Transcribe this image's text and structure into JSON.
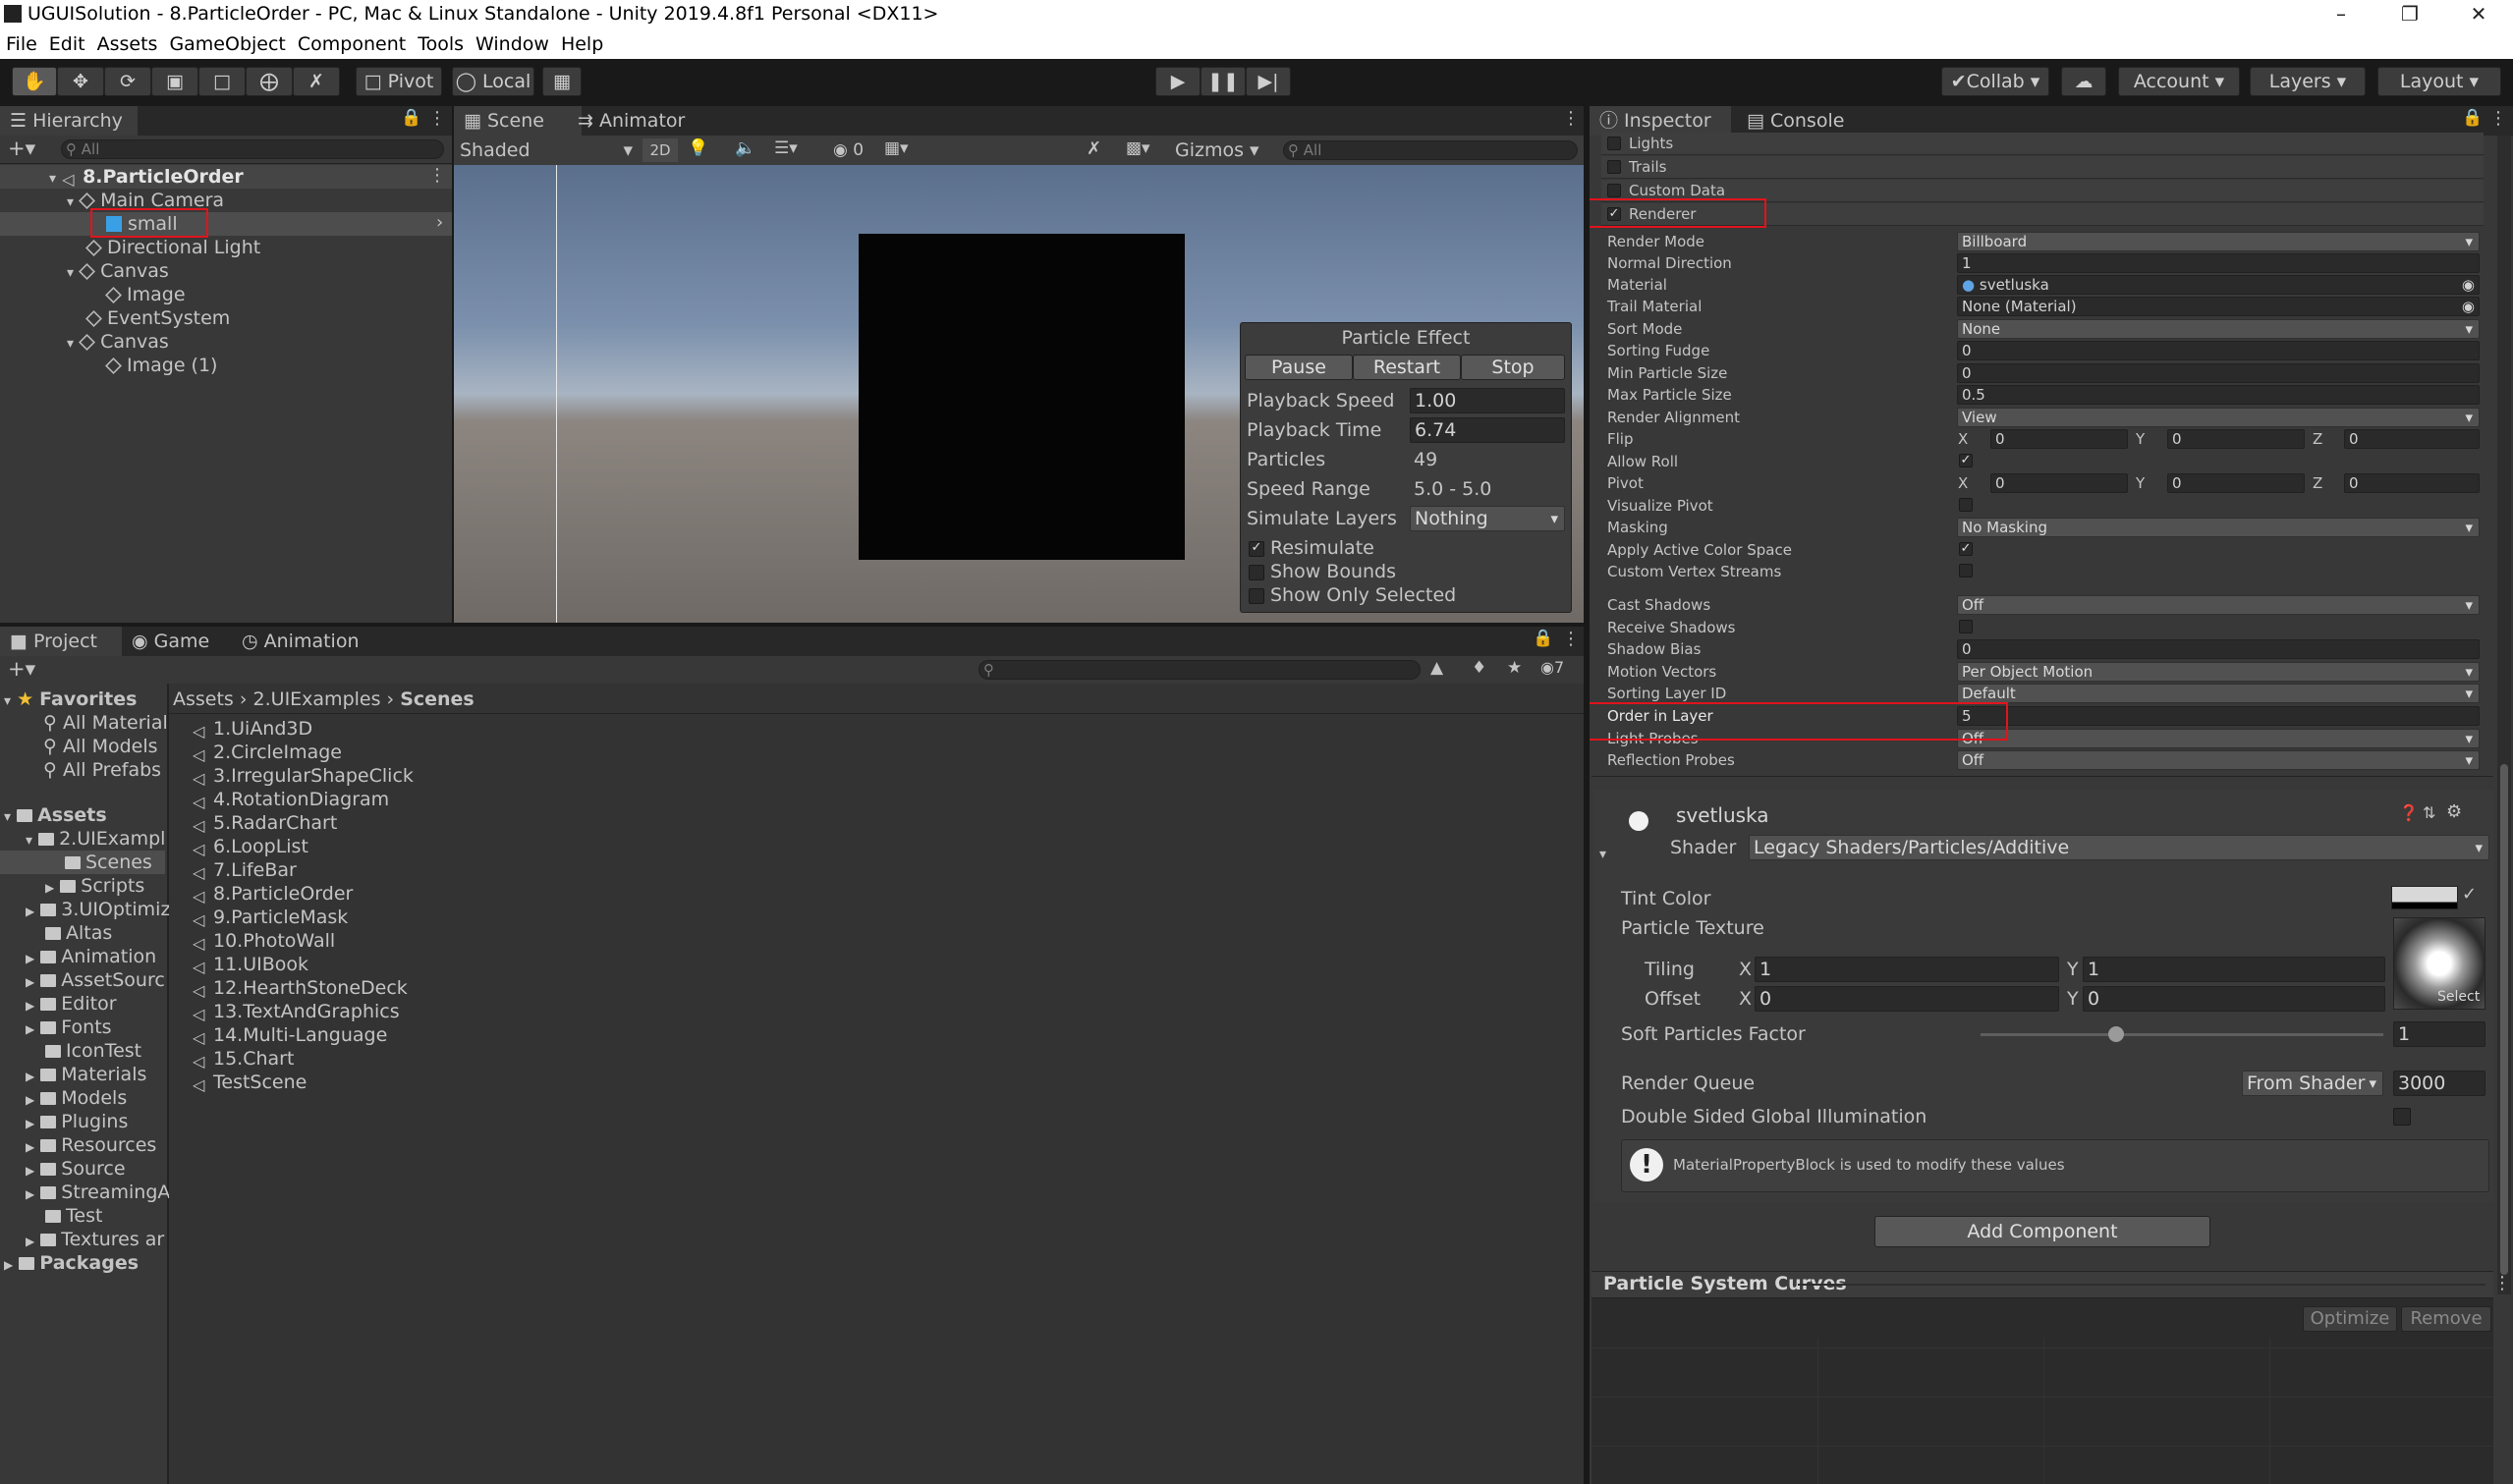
{
  "window": {
    "title": "UGUISolution - 8.ParticleOrder - PC, Mac & Linux Standalone - Unity 2019.4.8f1 Personal <DX11>"
  },
  "menu": [
    "File",
    "Edit",
    "Assets",
    "GameObject",
    "Component",
    "Tools",
    "Window",
    "Help"
  ],
  "toolbar": {
    "pivot": "Pivot",
    "local": "Local",
    "collab": "Collab",
    "account": "Account",
    "layers": "Layers",
    "layout": "Layout"
  },
  "hierarchy": {
    "tab": "Hierarchy",
    "search_placeholder": "All",
    "items": [
      "8.ParticleOrder",
      "Main Camera",
      "small",
      "Directional Light",
      "Canvas",
      "Image",
      "EventSystem",
      "Canvas",
      "Image (1)"
    ]
  },
  "scene": {
    "tabs": [
      "Scene",
      "Animator"
    ],
    "shading": "Shaded",
    "mode2d": "2D",
    "hidden_count": "0",
    "gizmos": "Gizmos",
    "search_placeholder": "All"
  },
  "particle_effect": {
    "title": "Particle Effect",
    "buttons": [
      "Pause",
      "Restart",
      "Stop"
    ],
    "rows": [
      {
        "label": "Playback Speed",
        "value": "1.00"
      },
      {
        "label": "Playback Time",
        "value": "6.74"
      },
      {
        "label": "Particles",
        "value": "49"
      },
      {
        "label": "Speed Range",
        "value": "5.0 - 5.0"
      },
      {
        "label": "Simulate Layers",
        "value": "Nothing"
      }
    ],
    "toggles": [
      {
        "label": "Resimulate",
        "checked": true
      },
      {
        "label": "Show Bounds",
        "checked": false
      },
      {
        "label": "Show Only Selected",
        "checked": false
      }
    ]
  },
  "project": {
    "tabs": [
      "Project",
      "Game",
      "Animation"
    ],
    "hidden_count": "7",
    "favorites_label": "Favorites",
    "favorites": [
      "All Material",
      "All Models",
      "All Prefabs"
    ],
    "assets_label": "Assets",
    "folders": [
      "2.UIExampl",
      "Scenes",
      "Scripts",
      "3.UIOptimiz",
      "Altas",
      "Animation",
      "AssetSourc",
      "Editor",
      "Fonts",
      "IconTest",
      "Materials",
      "Models",
      "Plugins",
      "Resources",
      "Source",
      "StreamingA",
      "Test",
      "Textures ar"
    ],
    "packages_label": "Packages",
    "breadcrumb": [
      "Assets",
      "2.UIExamples",
      "Scenes"
    ],
    "files": [
      "1.UiAnd3D",
      "2.CircleImage",
      "3.IrregularShapeClick",
      "4.RotationDiagram",
      "5.RadarChart",
      "6.LoopList",
      "7.LifeBar",
      "8.ParticleOrder",
      "9.ParticleMask",
      "10.PhotoWall",
      "11.UIBook",
      "12.HearthStoneDeck",
      "13.TextAndGraphics",
      "14.Multi-Language",
      "15.Chart",
      "TestScene"
    ]
  },
  "inspector": {
    "tabs": [
      "Inspector",
      "Console"
    ],
    "modules": [
      "Lights",
      "Trails",
      "Custom Data",
      "Renderer"
    ],
    "renderer": {
      "render_mode": {
        "label": "Render Mode",
        "value": "Billboard"
      },
      "normal_direction": {
        "label": "Normal Direction",
        "value": "1"
      },
      "material": {
        "label": "Material",
        "value": "svetluska"
      },
      "trail_material": {
        "label": "Trail Material",
        "value": "None (Material)"
      },
      "sort_mode": {
        "label": "Sort Mode",
        "value": "None"
      },
      "sorting_fudge": {
        "label": "Sorting Fudge",
        "value": "0"
      },
      "min_particle_size": {
        "label": "Min Particle Size",
        "value": "0"
      },
      "max_particle_size": {
        "label": "Max Particle Size",
        "value": "0.5"
      },
      "render_alignment": {
        "label": "Render Alignment",
        "value": "View"
      },
      "flip": {
        "label": "Flip",
        "x": "0",
        "y": "0",
        "z": "0"
      },
      "allow_roll": {
        "label": "Allow Roll"
      },
      "pivot": {
        "label": "Pivot",
        "x": "0",
        "y": "0",
        "z": "0"
      },
      "visualize_pivot": {
        "label": "Visualize Pivot"
      },
      "masking": {
        "label": "Masking",
        "value": "No Masking"
      },
      "apply_active_color_space": {
        "label": "Apply Active Color Space"
      },
      "custom_vertex_streams": {
        "label": "Custom Vertex Streams"
      },
      "cast_shadows": {
        "label": "Cast Shadows",
        "value": "Off"
      },
      "receive_shadows": {
        "label": "Receive Shadows"
      },
      "shadow_bias": {
        "label": "Shadow Bias",
        "value": "0"
      },
      "motion_vectors": {
        "label": "Motion Vectors",
        "value": "Per Object Motion"
      },
      "sorting_layer_id": {
        "label": "Sorting Layer ID",
        "value": "Default"
      },
      "order_in_layer": {
        "label": "Order in Layer",
        "value": "5"
      },
      "light_probes": {
        "label": "Light Probes",
        "value": "Off"
      },
      "reflection_probes": {
        "label": "Reflection Probes",
        "value": "Off"
      },
      "axis": {
        "x": "X",
        "y": "Y",
        "z": "Z"
      }
    },
    "material": {
      "name": "svetluska",
      "shader_label": "Shader",
      "shader": "Legacy Shaders/Particles/Additive",
      "tint_color": "Tint Color",
      "particle_texture": "Particle Texture",
      "select": "Select",
      "tiling": {
        "label": "Tiling",
        "x": "1",
        "y": "1"
      },
      "offset": {
        "label": "Offset",
        "x": "0",
        "y": "0"
      },
      "axis_x": "X",
      "axis_y": "Y",
      "soft_particles": {
        "label": "Soft Particles Factor",
        "value": "1"
      },
      "render_queue": {
        "label": "Render Queue",
        "mode": "From Shader",
        "value": "3000"
      },
      "double_sided_gi": "Double Sided Global Illumination",
      "info": "MaterialPropertyBlock is used to modify these values"
    },
    "add_component": "Add Component",
    "curves": {
      "title": "Particle System Curves",
      "optimize": "Optimize",
      "remove": "Remove"
    }
  },
  "colors": {
    "accent_red": "#e1141c",
    "selection_blue": "#2c5d87",
    "panel": "#383838"
  }
}
